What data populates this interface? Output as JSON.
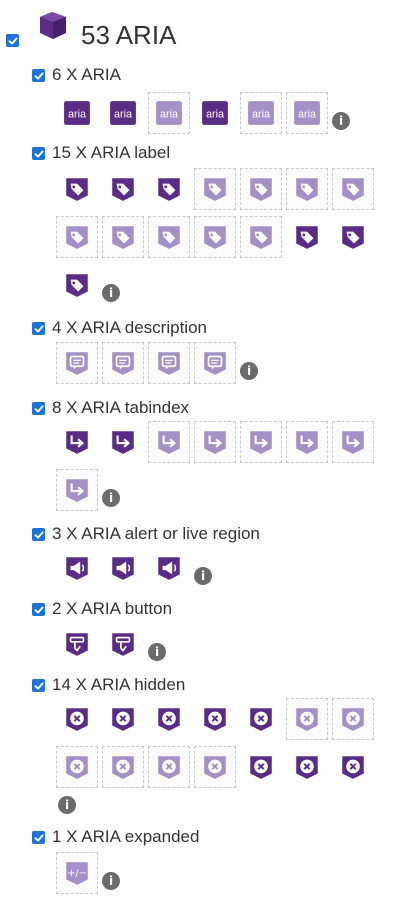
{
  "header": {
    "title": "53 ARIA",
    "checked": true
  },
  "colors": {
    "dark": "#5b2c86",
    "light": "#a58fc7",
    "checkbox": "#1f73d8"
  },
  "categories": [
    {
      "label": "6 X ARIA",
      "icon": "aria-text-icon",
      "items": [
        "dark",
        "dark",
        "light",
        "dark",
        "light",
        "light"
      ]
    },
    {
      "label": "15 X ARIA label",
      "icon": "tag-icon",
      "items": [
        "dark",
        "dark",
        "dark",
        "light",
        "light",
        "light",
        "light",
        "light",
        "light",
        "light",
        "light",
        "light",
        "dark",
        "dark",
        "dark"
      ]
    },
    {
      "label": "4 X ARIA description",
      "icon": "speech-bubble-icon",
      "items": [
        "light",
        "light",
        "light",
        "light"
      ]
    },
    {
      "label": "8 X ARIA tabindex",
      "icon": "tab-arrow-icon",
      "items": [
        "dark",
        "dark",
        "light",
        "light",
        "light",
        "light",
        "light",
        "light"
      ]
    },
    {
      "label": "3 X ARIA alert or live region",
      "icon": "megaphone-icon",
      "items": [
        "dark",
        "dark",
        "dark"
      ]
    },
    {
      "label": "2 X ARIA button",
      "icon": "button-icon",
      "items": [
        "dark",
        "dark"
      ]
    },
    {
      "label": "14 X ARIA hidden",
      "icon": "hidden-x-icon",
      "items": [
        "dark",
        "dark",
        "dark",
        "dark",
        "dark",
        "light",
        "light",
        "light",
        "light",
        "light",
        "light",
        "dark",
        "dark",
        "dark"
      ]
    },
    {
      "label": "1 X ARIA expanded",
      "icon": "expand-plus-minus-icon",
      "items": [
        "light"
      ]
    }
  ],
  "icon_text": {
    "aria": "aria",
    "expanded": "+/−"
  },
  "info_glyph": "i"
}
